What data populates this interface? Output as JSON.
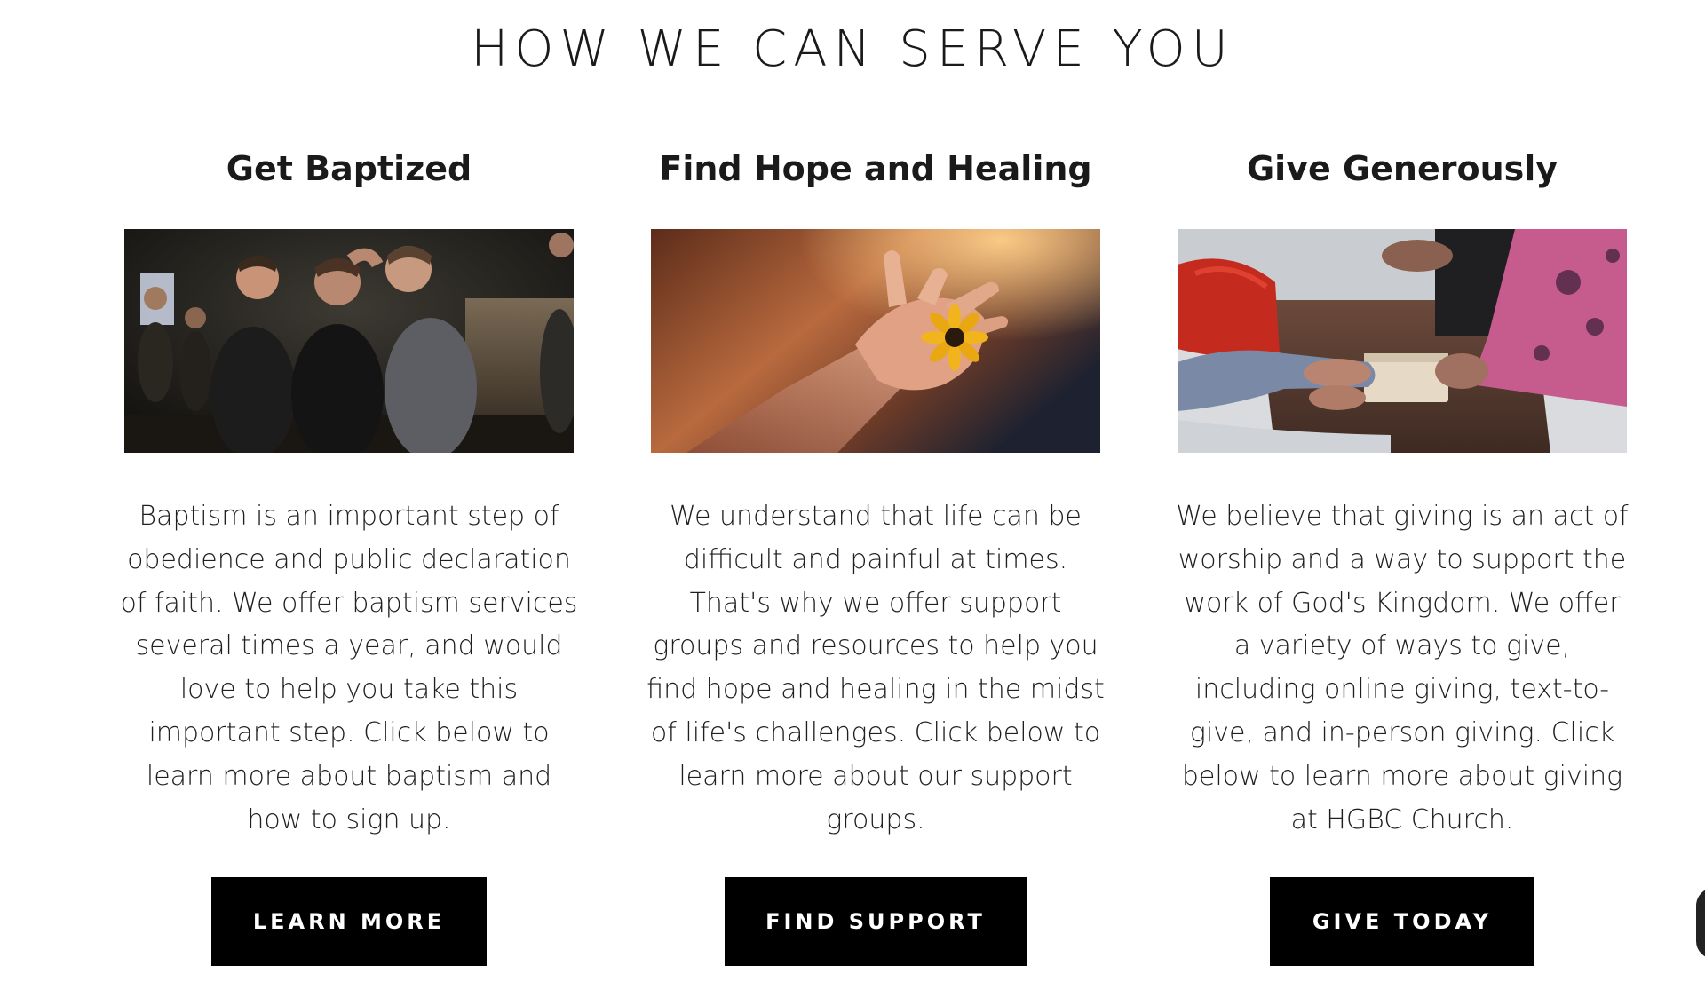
{
  "section": {
    "title": "HOW WE CAN SERVE YOU"
  },
  "cards": [
    {
      "title": "Get Baptized",
      "image_alt": "Group celebrating a baptism in water",
      "body": "Baptism is an important step of obedience and public declaration of faith. We offer baptism services several times a year, and would love to help you take this important step. Click below to learn more about baptism and how to sign up.",
      "button_label": "LEARN MORE"
    },
    {
      "title": "Find Hope and Healing",
      "image_alt": "Open hand holding a small yellow flower",
      "body": "We understand that life can be difficult and painful at times. That's why we offer support groups and resources to help you find hope and healing in the midst of life's challenges. Click below to learn more about our support groups.",
      "button_label": "FIND SUPPORT"
    },
    {
      "title": "Give Generously",
      "image_alt": "Hands passing a small box from one person to another",
      "body": "We believe that giving is an act of worship and a way to support the work of God's Kingdom. We offer a variety of ways to give, including online giving, text-to-give, and in-person giving. Click below to learn more about giving at HGBC Church.",
      "button_label": "GIVE TODAY"
    }
  ],
  "colors": {
    "button_bg": "#000000",
    "button_text": "#ffffff",
    "text": "#1a1a1a"
  }
}
